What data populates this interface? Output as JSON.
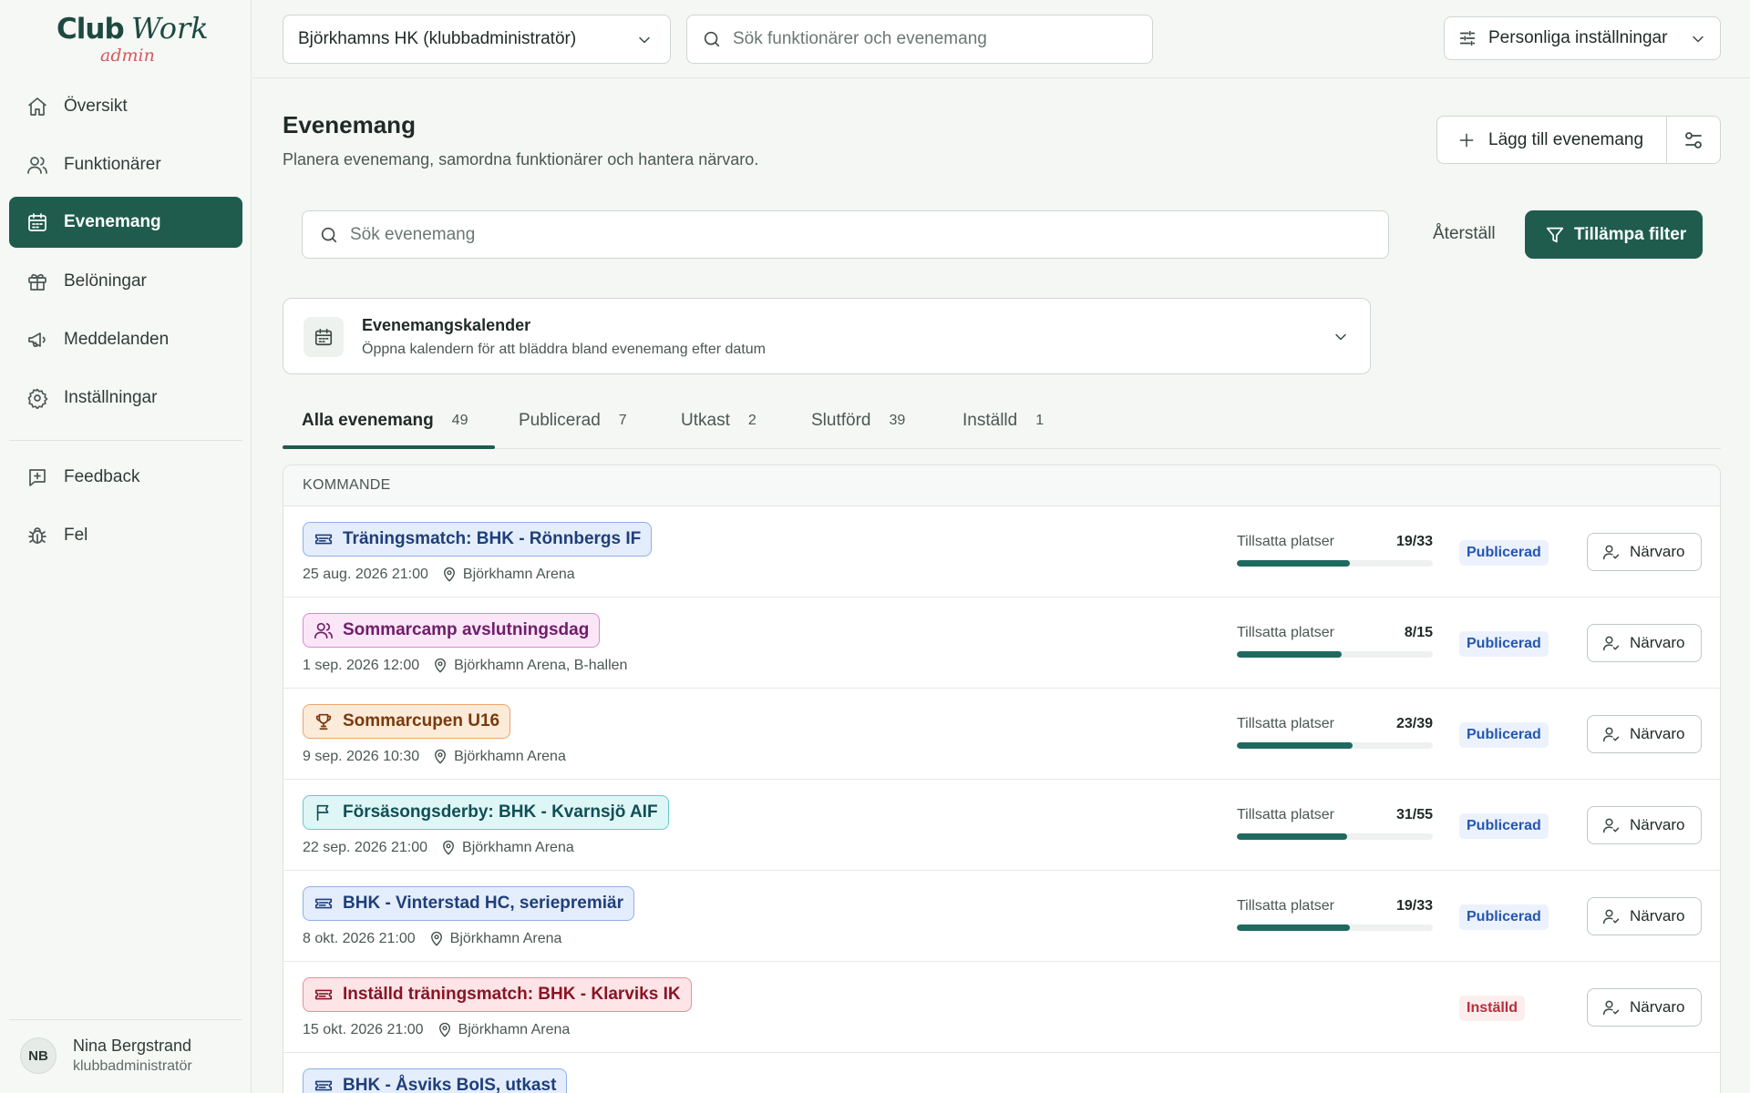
{
  "logo": {
    "club": "Club",
    "work": "Work",
    "admin": "admin"
  },
  "nav": [
    {
      "label": "Översikt",
      "icon": "home-icon"
    },
    {
      "label": "Funktionärer",
      "icon": "users-icon"
    },
    {
      "label": "Evenemang",
      "icon": "calendar-icon"
    },
    {
      "label": "Belöningar",
      "icon": "gift-icon"
    },
    {
      "label": "Meddelanden",
      "icon": "megaphone-icon"
    },
    {
      "label": "Inställningar",
      "icon": "gear-icon"
    }
  ],
  "nav_secondary": [
    {
      "label": "Feedback",
      "icon": "message-plus-icon"
    },
    {
      "label": "Fel",
      "icon": "bug-icon"
    }
  ],
  "user": {
    "initials": "NB",
    "name": "Nina Bergstrand",
    "role": "klubbadministratör"
  },
  "topbar": {
    "club": "Björkhamns HK (klubbadministratör)",
    "search_placeholder": "Sök funktionärer och evenemang",
    "settings_label": "Personliga inställningar"
  },
  "page": {
    "title": "Evenemang",
    "subtitle": "Planera evenemang, samordna funktionärer och hantera närvaro.",
    "add_label": "Lägg till evenemang"
  },
  "filters": {
    "search_placeholder": "Sök evenemang",
    "reset_label": "Återställ",
    "apply_label": "Tillämpa filter"
  },
  "calendar": {
    "title": "Evenemangskalender",
    "subtitle": "Öppna kalendern för att bläddra bland evenemang efter datum"
  },
  "tabs": [
    {
      "label": "Alla evenemang",
      "count": "49",
      "active": true
    },
    {
      "label": "Publicerad",
      "count": "7"
    },
    {
      "label": "Utkast",
      "count": "2"
    },
    {
      "label": "Slutförd",
      "count": "39"
    },
    {
      "label": "Inställd",
      "count": "1"
    }
  ],
  "section_title": "KOMMANDE",
  "slots_label": "Tillsatta platser",
  "attendance_label": "Närvaro",
  "events": [
    {
      "title": "Träningsmatch: BHK - Rönnbergs IF",
      "date": "25 aug. 2026 21:00",
      "location": "Björkhamn Arena",
      "color": "blue",
      "icon": "ticket-icon",
      "slots": "19/33",
      "filled": 19,
      "total": 33,
      "status": "Publicerad",
      "status_kind": "pub"
    },
    {
      "title": "Sommarcamp avslutningsdag",
      "date": "1 sep. 2026 12:00",
      "location": "Björkhamn Arena, B-hallen",
      "color": "purple",
      "icon": "users-icon",
      "slots": "8/15",
      "filled": 8,
      "total": 15,
      "status": "Publicerad",
      "status_kind": "pub"
    },
    {
      "title": "Sommarcupen U16",
      "date": "9 sep. 2026 10:30",
      "location": "Björkhamn Arena",
      "color": "orange",
      "icon": "trophy-icon",
      "slots": "23/39",
      "filled": 23,
      "total": 39,
      "status": "Publicerad",
      "status_kind": "pub"
    },
    {
      "title": "Försäsongsderby: BHK - Kvarnsjö AIF",
      "date": "22 sep. 2026 21:00",
      "location": "Björkhamn Arena",
      "color": "cyan",
      "icon": "flag-icon",
      "slots": "31/55",
      "filled": 31,
      "total": 55,
      "status": "Publicerad",
      "status_kind": "pub"
    },
    {
      "title": "BHK - Vinterstad HC, seriepremiär",
      "date": "8 okt. 2026 21:00",
      "location": "Björkhamn Arena",
      "color": "blue",
      "icon": "ticket-icon",
      "slots": "19/33",
      "filled": 19,
      "total": 33,
      "status": "Publicerad",
      "status_kind": "pub"
    },
    {
      "title": "Inställd träningsmatch: BHK - Klarviks IK",
      "date": "15 okt. 2026 21:00",
      "location": "Björkhamn Arena",
      "color": "red",
      "icon": "ticket-icon",
      "slots": "",
      "filled": null,
      "total": null,
      "status": "Inställd",
      "status_kind": "cancel"
    },
    {
      "title": "BHK - Åsviks BoIS, utkast",
      "date": "",
      "location": "",
      "color": "blue",
      "icon": "ticket-icon",
      "slots": "",
      "filled": null,
      "total": null,
      "status": "",
      "status_kind": ""
    }
  ]
}
